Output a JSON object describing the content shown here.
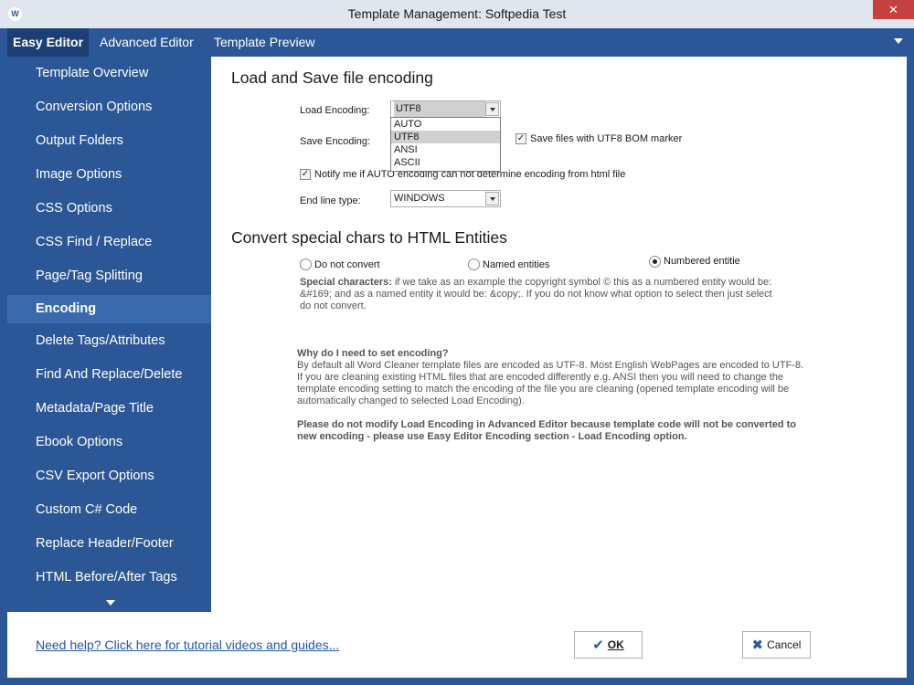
{
  "window": {
    "title": "Template Management: Softpedia Test",
    "app_icon_glyph": "W",
    "close_glyph": "✕"
  },
  "tabs": [
    {
      "label": "Easy Editor",
      "active": true
    },
    {
      "label": "Advanced Editor",
      "active": false
    },
    {
      "label": "Template Preview",
      "active": false
    }
  ],
  "sidebar": {
    "items": [
      {
        "label": "Template Overview"
      },
      {
        "label": "Conversion Options"
      },
      {
        "label": "Output Folders"
      },
      {
        "label": "Image Options"
      },
      {
        "label": "CSS Options"
      },
      {
        "label": "CSS Find / Replace"
      },
      {
        "label": "Page/Tag Splitting"
      },
      {
        "label": "Encoding",
        "active": true
      },
      {
        "label": "Delete Tags/Attributes"
      },
      {
        "label": "Find And Replace/Delete"
      },
      {
        "label": "Metadata/Page Title"
      },
      {
        "label": "Ebook Options"
      },
      {
        "label": "CSV Export Options"
      },
      {
        "label": "Custom C# Code"
      },
      {
        "label": "Replace Header/Footer"
      },
      {
        "label": "HTML Before/After Tags"
      }
    ]
  },
  "encoding": {
    "heading": "Load and Save file encoding",
    "load_label": "Load Encoding:",
    "load_value": "UTF8",
    "dropdown_options": [
      "AUTO",
      "UTF8",
      "ANSI",
      "ASCII"
    ],
    "save_label": "Save Encoding:",
    "bom_label": "Save files with UTF8 BOM marker",
    "bom_checked": true,
    "notify_label": "Notify me if AUTO encoding can not determine encoding from html file",
    "notify_checked": true,
    "endline_label": "End line type:",
    "endline_value": "WINDOWS",
    "checkmark_glyph": "✓"
  },
  "entities": {
    "heading": "Convert special chars to HTML Entities",
    "options": [
      {
        "label": "Do not convert",
        "selected": false
      },
      {
        "label": "Named entities",
        "selected": false
      },
      {
        "label": "Numbered entitie",
        "selected": true
      }
    ],
    "special_bold": "Special characters:",
    "special_line1": " if we take as an example the copyright symbol © this as a numbered entity would be:",
    "special_line2": "&#169; and as a named entity it would be: &copy;. If you do not know what option to select then just select",
    "special_line3": "do not convert."
  },
  "info": {
    "question": "Why do I need to set encoding?",
    "line1": "By default all Word Cleaner template files are encoded as UTF-8. Most English WebPages are encoded to UTF-8.",
    "line2": "If you are cleaning existing HTML files that are encoded differently e.g. ANSI then you will need to change the",
    "line3": "template encoding setting to match the encoding of the file you are cleaning (opened template encoding will be",
    "line4": "automatically changed to selected Load Encoding).",
    "warn1": "Please do not modify Load Encoding in Advanced Editor because template code will not be converted to",
    "warn2": "new encoding - please use Easy Editor Encoding section - Load Encoding option."
  },
  "footer": {
    "help_link": "Need help? Click here for tutorial videos and guides...",
    "ok_label": "OK",
    "cancel_label": "Cancel",
    "ok_glyph": "✔",
    "cancel_glyph": "✖"
  }
}
